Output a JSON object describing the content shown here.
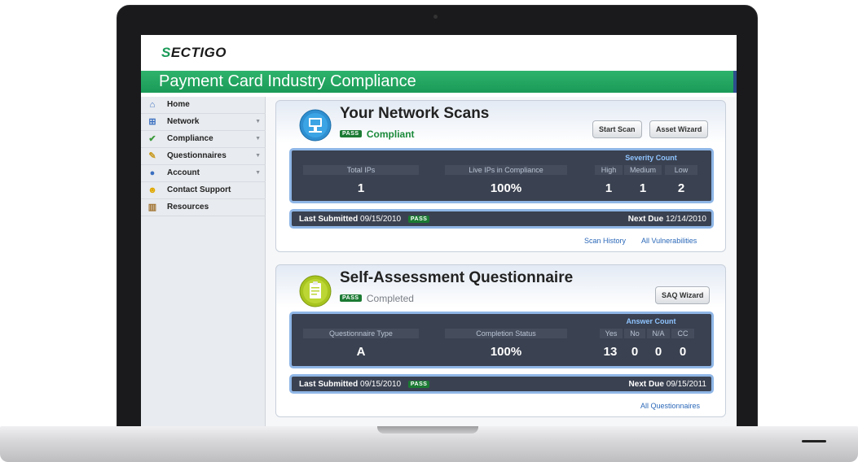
{
  "app": {
    "logo_text": "SECTIGO",
    "banner_title": "Payment Card Industry Compliance"
  },
  "sidebar": {
    "items": [
      {
        "label": "Home",
        "icon": "home-icon",
        "has_submenu": false
      },
      {
        "label": "Network",
        "icon": "network-icon",
        "has_submenu": true
      },
      {
        "label": "Compliance",
        "icon": "check-icon",
        "has_submenu": true
      },
      {
        "label": "Questionnaires",
        "icon": "pencil-icon",
        "has_submenu": true
      },
      {
        "label": "Account",
        "icon": "user-icon",
        "has_submenu": true
      },
      {
        "label": "Contact Support",
        "icon": "support-icon",
        "has_submenu": false
      },
      {
        "label": "Resources",
        "icon": "book-icon",
        "has_submenu": false
      }
    ]
  },
  "scans": {
    "title": "Your Network Scans",
    "pass_label": "PASS",
    "status": "Compliant",
    "buttons": {
      "start_scan": "Start Scan",
      "asset_wizard": "Asset Wizard"
    },
    "stats": {
      "total_ips_label": "Total IPs",
      "total_ips": "1",
      "live_label": "Live IPs in Compliance",
      "live_value": "100%",
      "severity_heading": "Severity Count",
      "high_label": "High",
      "medium_label": "Medium",
      "low_label": "Low",
      "high": "1",
      "medium": "1",
      "low": "2"
    },
    "submitted": {
      "last_label": "Last Submitted",
      "last_date": "09/15/2010",
      "pass_label": "PASS",
      "next_label": "Next Due",
      "next_date": "12/14/2010"
    },
    "links": {
      "history": "Scan History",
      "vulns": "All Vulnerabilities"
    }
  },
  "saq": {
    "title": "Self-Assessment Questionnaire",
    "pass_label": "PASS",
    "status": "Completed",
    "buttons": {
      "wizard": "SAQ Wizard"
    },
    "stats": {
      "type_label": "Questionnaire Type",
      "type_value": "A",
      "completion_label": "Completion Status",
      "completion_value": "100%",
      "answer_heading": "Answer Count",
      "yes_label": "Yes",
      "no_label": "No",
      "na_label": "N/A",
      "cc_label": "CC",
      "yes": "13",
      "no": "0",
      "na": "0",
      "cc": "0"
    },
    "submitted": {
      "last_label": "Last Submitted",
      "last_date": "09/15/2010",
      "pass_label": "PASS",
      "next_label": "Next Due",
      "next_date": "09/15/2011"
    },
    "links": {
      "all": "All Questionnaires"
    }
  },
  "colors": {
    "brand_green": "#1a9a57",
    "stats_bg": "#3a4150",
    "stats_border": "#8fb6e6",
    "pass_green": "#1b7a33",
    "link_blue": "#2b68b8"
  }
}
